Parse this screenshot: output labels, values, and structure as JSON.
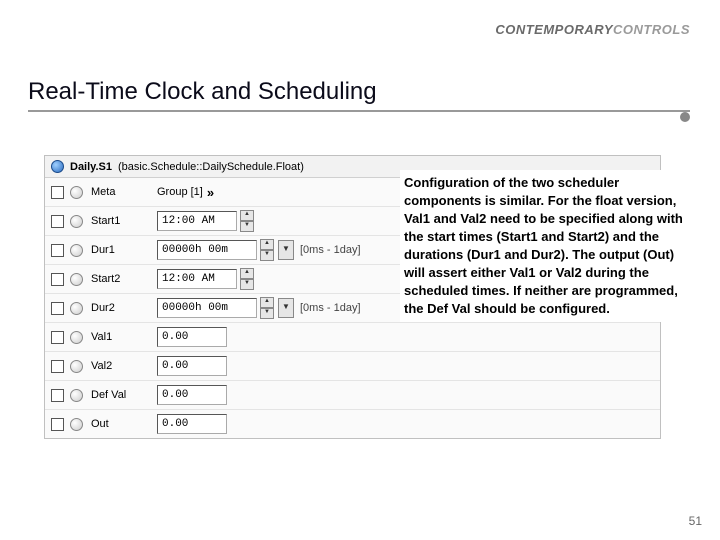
{
  "logo": {
    "part1": "CONTEMPORARY",
    "part2": "CONTROLS"
  },
  "title": "Real-Time Clock and Scheduling",
  "page_number": "51",
  "panel": {
    "header_orb": "component-icon",
    "header_name": "Daily.S1",
    "header_type": "(basic.Schedule::DailySchedule.Float)"
  },
  "rows": {
    "meta": {
      "label": "Meta",
      "value": "Group [1]",
      "chev": "»"
    },
    "start1": {
      "label": "Start1",
      "value": "12:00 AM"
    },
    "dur1": {
      "label": "Dur1",
      "value": "00000h 00m",
      "hint": "[0ms - 1day]"
    },
    "start2": {
      "label": "Start2",
      "value": "12:00 AM"
    },
    "dur2": {
      "label": "Dur2",
      "value": "00000h 00m",
      "hint": "[0ms - 1day]"
    },
    "val1": {
      "label": "Val1",
      "value": "0.00"
    },
    "val2": {
      "label": "Val2",
      "value": "0.00"
    },
    "defval": {
      "label": "Def Val",
      "value": "0.00"
    },
    "out": {
      "label": "Out",
      "value": "0.00"
    }
  },
  "description": "Configuration of the two scheduler components is similar. For the float version, Val1 and Val2 need to be specified along with the start times (Start1 and Start2) and the durations (Dur1 and Dur2). The output (Out) will assert either Val1 or Val2 during the scheduled times. If neither are programmed, the Def Val should be configured.",
  "glyphs": {
    "up": "▲",
    "down": "▼",
    "drop": "▼"
  }
}
